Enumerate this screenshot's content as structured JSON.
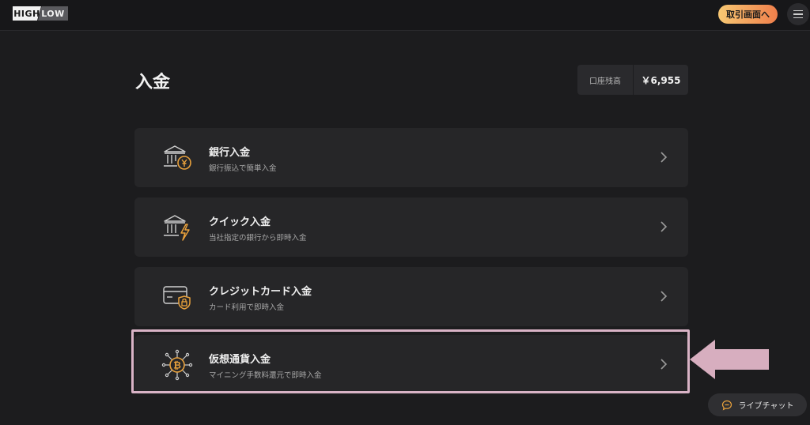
{
  "header": {
    "logo_left": "HIGH",
    "logo_right": "LOW",
    "trade_button": "取引画面へ"
  },
  "page": {
    "title": "入金",
    "balance_label": "口座残高",
    "balance_value": "￥6,955"
  },
  "methods": [
    {
      "title": "銀行入金",
      "subtitle": "銀行振込で簡単入金",
      "icon": "bank-yen-icon"
    },
    {
      "title": "クイック入金",
      "subtitle": "当社指定の銀行から即時入金",
      "icon": "bank-lightning-icon"
    },
    {
      "title": "クレジットカード入金",
      "subtitle": "カード利用で即時入金",
      "icon": "credit-card-lock-icon"
    },
    {
      "title": "仮想通貨入金",
      "subtitle": "マイニング手数料還元で即時入金",
      "icon": "bitcoin-network-icon"
    }
  ],
  "chat": {
    "label": "ライブチャット",
    "icon": "chat-bubble-icon"
  },
  "colors": {
    "accent_gold": "#e8a13c",
    "highlight": "#d9b3c6",
    "background": "#1c1c1e",
    "card": "#262628"
  }
}
